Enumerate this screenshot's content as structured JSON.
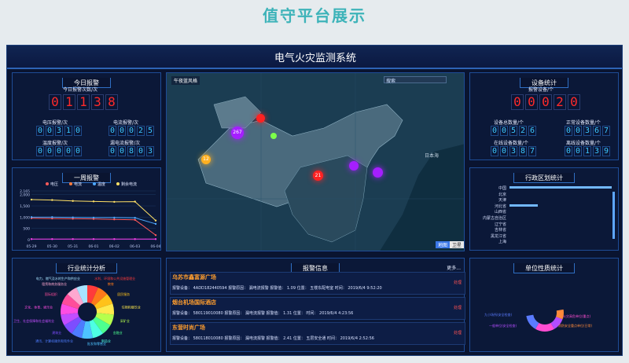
{
  "page_title": "值守平台展示",
  "system_title": "电气火灾监测系统",
  "today_alarm": {
    "title": "今日报警",
    "total_label": "今日报警次数/次",
    "total_digits": [
      "0",
      "1",
      "1",
      "3",
      "8"
    ],
    "items": [
      {
        "label": "电压报警/次",
        "digits": [
          "0",
          "0",
          "3",
          "1",
          "0"
        ]
      },
      {
        "label": "电流报警/次",
        "digits": [
          "0",
          "0",
          "0",
          "2",
          "5"
        ]
      },
      {
        "label": "温度报警/次",
        "digits": [
          "0",
          "0",
          "0",
          "0",
          "0"
        ]
      },
      {
        "label": "漏电流报警/次",
        "digits": [
          "0",
          "0",
          "8",
          "0",
          "3"
        ]
      }
    ]
  },
  "week_alarm": {
    "title": "一周报警",
    "legend": [
      "电压",
      "电流",
      "温度",
      "剩余电流"
    ],
    "colors": [
      "#ff5a5a",
      "#ff7a3a",
      "#4ea8ff",
      "#ffe066"
    ],
    "y_ticks": [
      "2,165",
      "2,000",
      "1,500",
      "1,000",
      "500",
      "0"
    ],
    "x_ticks": [
      "05-29",
      "05-30",
      "05-31",
      "06-01",
      "06-02",
      "06-03",
      "06-04"
    ]
  },
  "chart_data": {
    "type": "line",
    "categories": [
      "05-29",
      "05-30",
      "05-31",
      "06-01",
      "06-02",
      "06-03",
      "06-04"
    ],
    "ylim": [
      0,
      2165
    ],
    "series": [
      {
        "name": "电压",
        "values": [
          950,
          940,
          930,
          920,
          900,
          880,
          200
        ]
      },
      {
        "name": "电流",
        "values": [
          25,
          25,
          25,
          25,
          25,
          25,
          25
        ]
      },
      {
        "name": "温度",
        "values": [
          1000,
          1000,
          990,
          980,
          980,
          970,
          700
        ]
      },
      {
        "name": "剩余电流",
        "values": [
          1780,
          1760,
          1720,
          1700,
          1680,
          1690,
          850
        ]
      }
    ]
  },
  "industry": {
    "title": "行业统计分析",
    "labels": [
      "水利、环境和公共设施管理业",
      "教育",
      "居民服务",
      "住宿和餐饮业",
      "采矿业",
      "金融业",
      "制造业",
      "批发和零售业",
      "通讯、计算机服务和软件业",
      "建筑业",
      "卫生、社会保障和社会福利业",
      "文化、体育、娱乐业",
      "国际组织",
      "租赁和商务服务业",
      "电力、燃气及水的生产和供应业"
    ]
  },
  "map": {
    "layer_label": "午夜蓝风格",
    "search_label": "搜索",
    "sea_label": "日本海",
    "btn_map": "地图",
    "btn_satellite": "卫星",
    "markers": [
      {
        "label": "267",
        "color": "#a51fff"
      },
      {
        "label": "12",
        "color": "#ffb020"
      },
      {
        "label": "21",
        "color": "#ff2222"
      },
      {
        "label": "",
        "color": "#ff2222"
      },
      {
        "label": "",
        "color": "#a51fff"
      },
      {
        "label": "",
        "color": "#a51fff"
      }
    ]
  },
  "alarm_info": {
    "title": "报警信息",
    "more": "更多...",
    "rows": [
      {
        "name": "乌苏市鑫富源广场",
        "info": "报警设备： 4ADD18244059​4  报警原因： 漏电流报警  报警值： 1.09  位置： 五楼东配电室  时间： 2019/6/4 9:52:20",
        "action": "处理"
      },
      {
        "name": "烟台机场国际酒店",
        "info": "报警设备： 580119010080  报警原因： 漏电流报警  报警值： 1.31  位置：  时间： 2019/6/4 4:23:56",
        "action": "处理"
      },
      {
        "name": "东营时尚广场",
        "info": "报警设备： 580118010080  报警原因： 漏电流报警  报警值： 2.41  位置： 五层安全通  时间： 2019/6/4 2:52:56",
        "action": "处理"
      }
    ]
  },
  "device_stats": {
    "title": "设备统计",
    "subtitle": "报警设备/个",
    "alarm_digits": [
      "0",
      "0",
      "0",
      "2",
      "0"
    ],
    "items": [
      {
        "label": "设备总数量/个",
        "digits": [
          "0",
          "0",
          "5",
          "2",
          "6"
        ]
      },
      {
        "label": "正常设备数量/个",
        "digits": [
          "0",
          "0",
          "3",
          "6",
          "7"
        ]
      },
      {
        "label": "在线设备数量/个",
        "digits": [
          "0",
          "0",
          "3",
          "8",
          "7"
        ]
      },
      {
        "label": "离线设备数量/个",
        "digits": [
          "0",
          "0",
          "1",
          "3",
          "9"
        ]
      }
    ]
  },
  "region": {
    "title": "行政区划统计",
    "items": [
      "中国",
      "北京",
      "天津",
      "河北省",
      "山西省",
      "内蒙古自治区",
      "辽宁省",
      "吉林省",
      "黑龙江省",
      "上海"
    ]
  },
  "unit_nature": {
    "title": "单位性质统计",
    "labels": [
      "九小场所(安全检查)",
      "火灾高危单位(重点)",
      "一般单位(安全检查)",
      "消防安全重点单位(日常)"
    ]
  }
}
